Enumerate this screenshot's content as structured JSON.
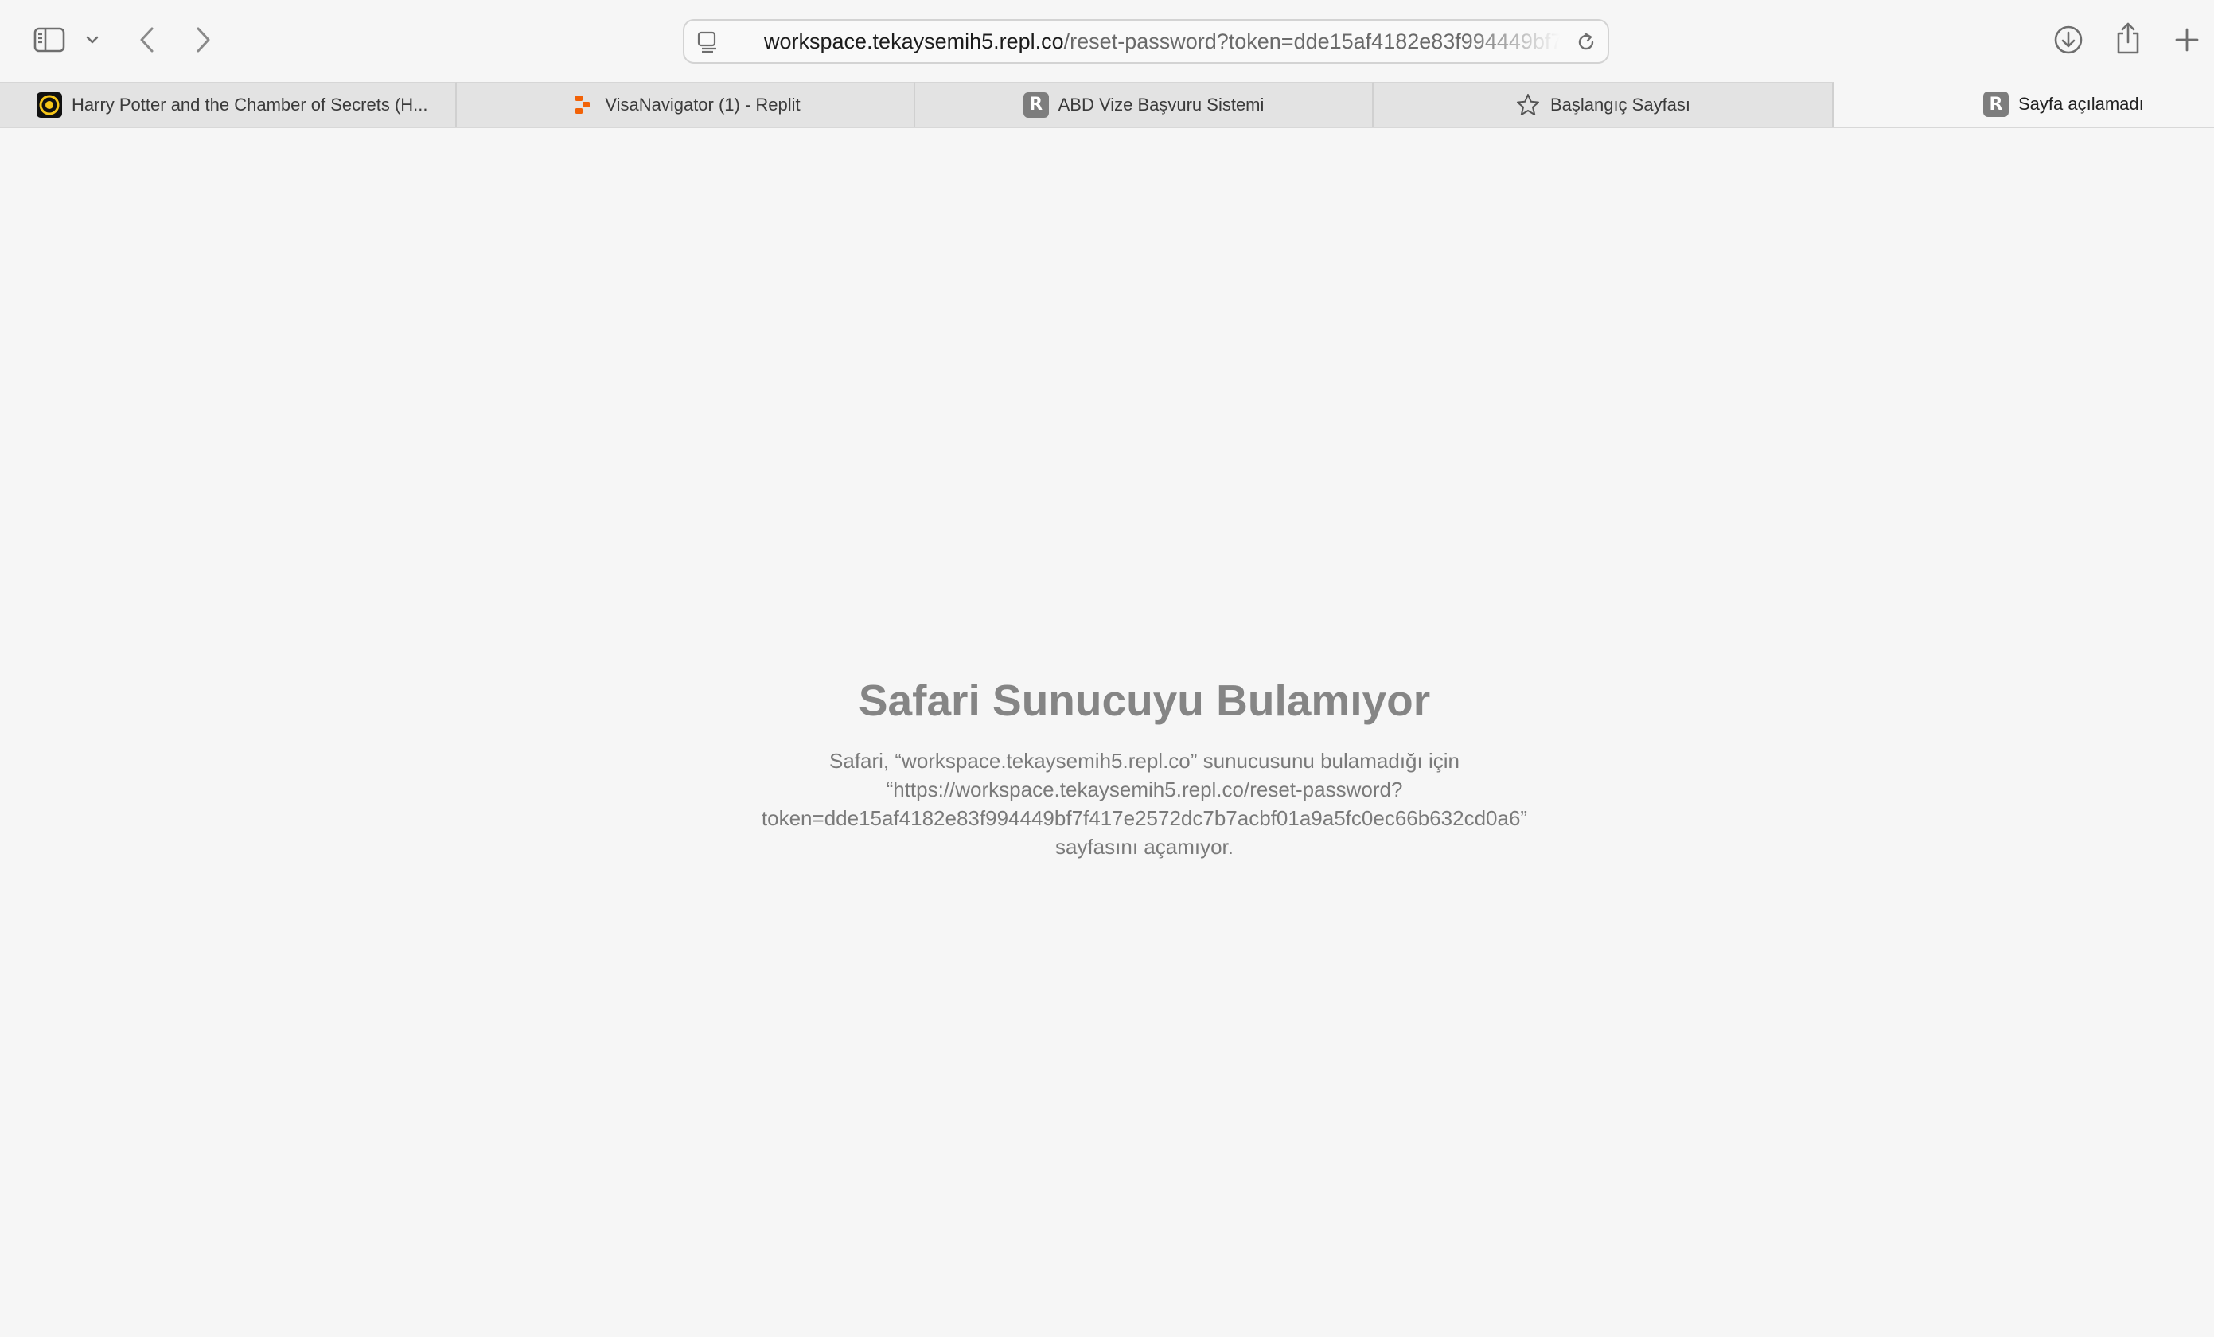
{
  "toolbar": {
    "sidebar_icon": "sidebar-icon",
    "chevron_icon": "chevron-down-icon",
    "back_icon": "back-arrow-icon",
    "forward_icon": "forward-arrow-icon",
    "download_icon": "download-icon",
    "share_icon": "share-icon",
    "new_tab_icon": "plus-icon"
  },
  "address_bar": {
    "host": "workspace.tekaysemih5.repl.co",
    "path": "/reset-password?token=dde15af4182e83f994449bf7f417e2572dc7b7acbf01a9a5fc0ec66b632cd0a6"
  },
  "tabs": [
    {
      "label": "Harry Potter and the Chamber of Secrets (H...",
      "favicon": "hp-circle-icon",
      "active": false
    },
    {
      "label": "VisaNavigator (1) - Replit",
      "favicon": "replit-icon",
      "active": false
    },
    {
      "label": "ABD Vize Başvuru Sistemi",
      "favicon": "r-letter-icon",
      "favicon_text": "R",
      "active": false
    },
    {
      "label": "Başlangıç Sayfası",
      "favicon": "star-icon",
      "active": false
    },
    {
      "label": "Sayfa açılamadı",
      "favicon": "r-letter-icon",
      "favicon_text": "R",
      "active": true
    }
  ],
  "error": {
    "title": "Safari Sunucuyu Bulamıyor",
    "lines": [
      "Safari, “workspace.tekaysemih5.repl.co” sunucusunu bulamadığı için",
      "“https://workspace.tekaysemih5.repl.co/reset-password?",
      "token=dde15af4182e83f994449bf7f417e2572dc7b7acbf01a9a5fc0ec66b632cd0a6”",
      "sayfasını açamıyor."
    ]
  },
  "colors": {
    "background": "#f6f6f6",
    "tab_inactive": "#e3e3e3",
    "title_text": "#858585",
    "body_text": "#7a7a7a",
    "replit_orange": "#f26207",
    "hp_yellow": "#f5c518"
  }
}
